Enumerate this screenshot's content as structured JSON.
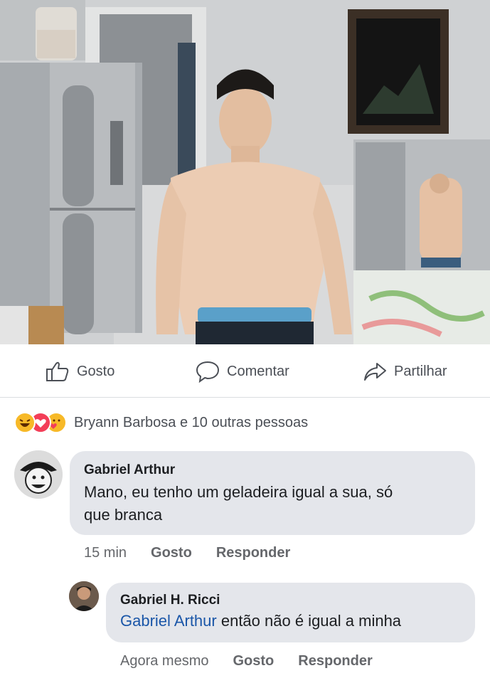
{
  "post": {
    "photo_icon": "photo-of-man-in-kitchen"
  },
  "actions": {
    "like_label": "Gosto",
    "comment_label": "Comentar",
    "share_label": "Partilhar",
    "like_icon": "thumbs-up-icon",
    "comment_icon": "speech-bubble-icon",
    "share_icon": "share-arrow-icon"
  },
  "reactions": {
    "summary": "Bryann Barbosa e 10 outras pessoas",
    "icons": [
      "laugh-reaction-icon",
      "love-reaction-icon",
      "care-reaction-icon"
    ]
  },
  "comments": [
    {
      "author": "Gabriel Arthur",
      "text_line1": "Mano, eu tenho um geladeira igual a sua, só",
      "text_line2": "que branca",
      "time": "15 min",
      "like": "Gosto",
      "reply": "Responder"
    },
    {
      "author": "Gabriel H. Ricci",
      "mention": "Gabriel Arthur",
      "text": " então não é igual a minha",
      "time": "Agora mesmo",
      "like": "Gosto",
      "reply": "Responder"
    }
  ],
  "colors": {
    "mention": "#1a56a8",
    "bubble": "#e4e6eb",
    "meta_text": "#65676b"
  }
}
